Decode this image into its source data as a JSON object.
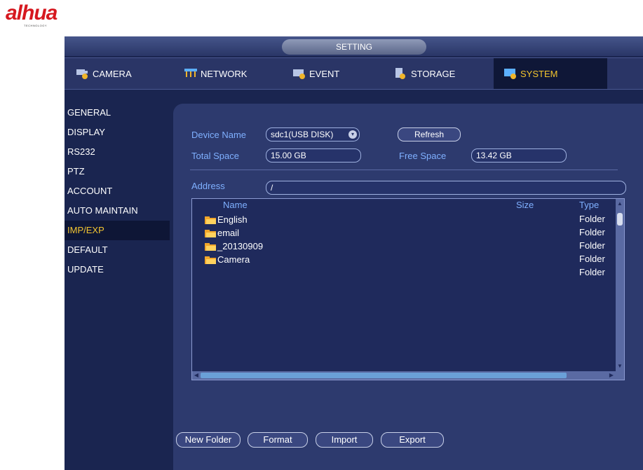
{
  "brand": {
    "logo_text": "alhua",
    "logo_sub": "TECHNOLOGY"
  },
  "window": {
    "title": "SETTING"
  },
  "tabs": [
    {
      "label": "CAMERA",
      "icon": "camera-icon",
      "active": false
    },
    {
      "label": "NETWORK",
      "icon": "network-icon",
      "active": false
    },
    {
      "label": "EVENT",
      "icon": "event-icon",
      "active": false
    },
    {
      "label": "STORAGE",
      "icon": "storage-icon",
      "active": false
    },
    {
      "label": "SYSTEM",
      "icon": "system-icon",
      "active": true
    }
  ],
  "sidebar": {
    "items": [
      {
        "label": "GENERAL",
        "active": false
      },
      {
        "label": "DISPLAY",
        "active": false
      },
      {
        "label": "RS232",
        "active": false
      },
      {
        "label": "PTZ",
        "active": false
      },
      {
        "label": "ACCOUNT",
        "active": false
      },
      {
        "label": "AUTO MAINTAIN",
        "active": false
      },
      {
        "label": "IMP/EXP",
        "active": true
      },
      {
        "label": "DEFAULT",
        "active": false
      },
      {
        "label": "UPDATE",
        "active": false
      }
    ]
  },
  "form": {
    "device_name_label": "Device Name",
    "device_name_value": "sdc1(USB DISK)",
    "refresh_label": "Refresh",
    "total_space_label": "Total Space",
    "total_space_value": "15.00 GB",
    "free_space_label": "Free Space",
    "free_space_value": "13.42 GB",
    "address_label": "Address",
    "address_value": "/"
  },
  "file_list": {
    "columns": {
      "name": "Name",
      "size": "Size",
      "type": "Type"
    },
    "rows": [
      {
        "name": "English",
        "size": "",
        "type": "Folder"
      },
      {
        "name": "email",
        "size": "",
        "type": "Folder"
      },
      {
        "name": "_20130909",
        "size": "",
        "type": "Folder"
      },
      {
        "name": "Camera",
        "size": "",
        "type": "Folder"
      }
    ],
    "extra_type": "Folder"
  },
  "buttons": {
    "new_folder": "New Folder",
    "format": "Format",
    "import": "Import",
    "export": "Export"
  },
  "colors": {
    "accent": "#f3c52d",
    "label_blue": "#7fb0ff",
    "folder": "#f2a62a"
  }
}
